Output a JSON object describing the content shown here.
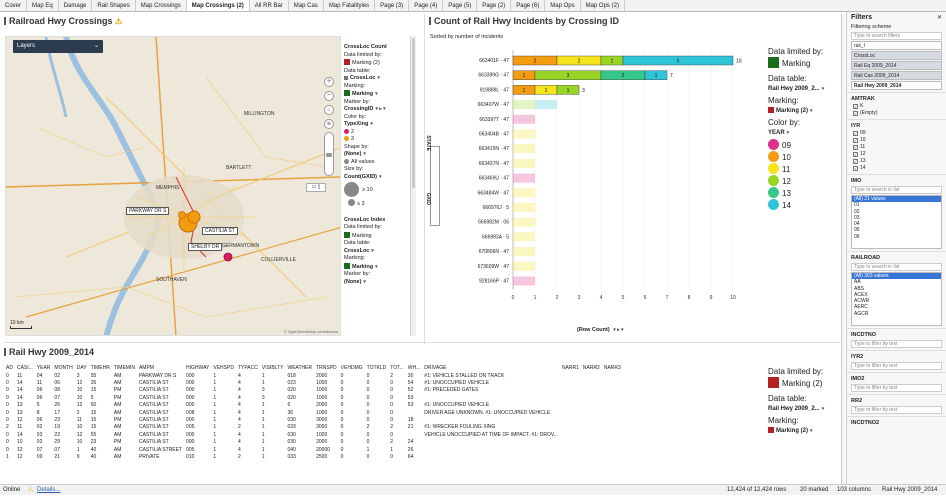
{
  "tabs": [
    "Cover",
    "Map Eq",
    "Damage",
    "Rail Shapes",
    "Map Crossings",
    "Map Crossings (2)",
    "All RR Bar",
    "Map Cas",
    "Map Fatalityies",
    "Page (3)",
    "Page (4)",
    "Page (5)",
    "Page (2)",
    "Page (6)",
    "Map Ops",
    "Map Ops (2)"
  ],
  "map_panel": {
    "title": "Railroad Hwy Crossings",
    "layers_label": "Layers",
    "scale_label": "10 km",
    "copyright": "© OpenStreetMap contributors",
    "places": [
      "MEMPHIS",
      "GERMANTOWN",
      "COLLIERVILLE",
      "SOUTHAVEN",
      "BARTLETT",
      "MILLINGTON"
    ],
    "callouts": [
      "PARKWAY DR S",
      "CASTILIA ST",
      "SHELBY DR"
    ]
  },
  "map_legend": {
    "title1": "CrossLoc Count",
    "limited_by": "Data limited by:",
    "marking2": "Marking (2)",
    "table_lbl": "Data table:",
    "table_val": "CrossLoc",
    "marking_lbl": "Marking:",
    "marking_val": "Marking",
    "marker_by_lbl": "Marker by:",
    "marker_by_val": "CrossingID",
    "color_by_lbl": "Color by:",
    "color_by_val": "TypeXing",
    "color_vals": [
      "2",
      "3"
    ],
    "shape_by_lbl": "Shape by:",
    "shape_by_val": "(None)",
    "all_values": "All values",
    "size_by_lbl": "Size by:",
    "size_by_val": "Count(GXID)",
    "size_vals": [
      "≥ 10",
      "≤ 3"
    ],
    "index_title": "CrossLoc Index",
    "limited_by2": "Data limited by:",
    "marking3": "Marking",
    "table_lbl2": "Data table:",
    "table_val2": "CrossLoc",
    "marking_lbl2": "Marking:",
    "marking_val2": "Marking",
    "marker_by_lbl2": "Marker by:",
    "marker_by_val2": "(None)"
  },
  "chart_panel": {
    "title": "Count of Rail Hwy Incidents by Crossing ID",
    "subtitle": "Sorted by number of incidents",
    "x_axis_title": "(Row Count)",
    "shelf_a": "STATE",
    "shelf_b": "GXID"
  },
  "chart_legend": {
    "limited_by": "Data limited by:",
    "marking": "Marking",
    "table_lbl": "Data table:",
    "table_val": "Rail Hwy 2009_2...",
    "marking_lbl": "Marking:",
    "marking_val": "Marking (2)",
    "color_by_lbl": "Color by:",
    "color_by_val": "YEAR",
    "years": [
      "09",
      "10",
      "11",
      "12",
      "13",
      "14"
    ],
    "year_colors": [
      "#e0318a",
      "#f39c12",
      "#f5e31b",
      "#9ad425",
      "#34c98a",
      "#2ec5d8"
    ]
  },
  "chart_data": {
    "type": "bar",
    "orientation": "horizontal",
    "stacked": true,
    "categories": [
      "663401F · 47",
      "663399G · 47",
      "919889L · 47",
      "663407W · 47",
      "663397T · 47",
      "663404B · 47",
      "663415N · 47",
      "663437N · 47",
      "663469U · 47",
      "663484W · 47",
      "666976J · 5",
      "666982M · 06",
      "666993A · 5",
      "670806N · 47",
      "673609W · 47",
      "928166P · 47"
    ],
    "xlim": [
      0,
      10
    ],
    "x_ticks": [
      "0",
      "1",
      "2",
      "3",
      "4",
      "5",
      "6",
      "7",
      "8",
      "9",
      "10"
    ],
    "series": [
      {
        "name": "09",
        "color": "#e0318a",
        "values": [
          0,
          0,
          0,
          0,
          1,
          0,
          0,
          0,
          1,
          0,
          0,
          0,
          0,
          0,
          0,
          1
        ]
      },
      {
        "name": "10",
        "color": "#f39c12",
        "values": [
          2,
          1,
          1,
          0,
          0,
          0,
          0,
          0,
          0,
          0,
          0,
          0,
          0,
          0,
          0,
          0
        ]
      },
      {
        "name": "11",
        "color": "#f5e31b",
        "values": [
          2,
          0,
          1,
          0,
          0,
          1,
          1,
          1,
          0,
          1,
          1,
          1,
          1,
          1,
          1,
          0
        ]
      },
      {
        "name": "12",
        "color": "#9ad425",
        "values": [
          1,
          3,
          1,
          1,
          0,
          0,
          0,
          0,
          0,
          0,
          0,
          0,
          0,
          0,
          0,
          0
        ]
      },
      {
        "name": "13",
        "color": "#34c98a",
        "values": [
          0,
          2,
          0,
          0,
          0,
          0,
          0,
          0,
          0,
          0,
          0,
          0,
          0,
          0,
          0,
          0
        ]
      },
      {
        "name": "14",
        "color": "#2ec5d8",
        "values": [
          5,
          1,
          0,
          1,
          0,
          0,
          0,
          0,
          0,
          0,
          0,
          0,
          0,
          0,
          0,
          0
        ]
      }
    ],
    "marked_rows": [
      0,
      1,
      2
    ],
    "totals": [
      "10",
      "7",
      "3",
      "",
      "",
      "",
      "",
      "",
      "",
      "",
      "",
      "",
      "",
      "",
      "",
      ""
    ]
  },
  "table_panel": {
    "title": "Rail Hwy 2009_2014",
    "columns": [
      "AD",
      "CASI...",
      "YEAR",
      "MONTH",
      "DAY",
      "TIMEHR",
      "TIMEMIN",
      "AMPM",
      "HIGHWAY",
      "VEHSPD",
      "TYPACC",
      "VISIBLTY",
      "WEATHER",
      "TRNSPD",
      "VEHDMG",
      "TOTKLD",
      "TOT...",
      "WH...",
      "DRIVAGE",
      "NARR1",
      "NARR2",
      "NARR3"
    ],
    "rows": [
      [
        "0",
        "11",
        "04",
        "02",
        "3",
        "55",
        "AM",
        "PARKWAY DR S",
        "000",
        "1",
        "4",
        "1",
        "018",
        "2000",
        "0",
        "0",
        "2",
        "30",
        "#1: VEHICLE STALLED ON TRACK",
        "",
        ""
      ],
      [
        "0",
        "14",
        "11",
        "06",
        "12",
        "35",
        "AM",
        "CASTILIA ST",
        "000",
        "1",
        "4",
        "1",
        "023",
        "1000",
        "0",
        "0",
        "0",
        "54",
        "#1: UNOCCUPIED VEHICLE",
        "",
        ""
      ],
      [
        "0",
        "14",
        "06",
        "08",
        "10",
        "15",
        "PM",
        "CASTILIA ST",
        "000",
        "1",
        "4",
        "3",
        "020",
        "1000",
        "0",
        "0",
        "0",
        "52",
        "#1: PRECEDED GATES",
        "",
        ""
      ],
      [
        "0",
        "14",
        "06",
        "07",
        "10",
        "5",
        "PM",
        "CASTILIA ST",
        "000",
        "1",
        "4",
        "3",
        "020",
        "1000",
        "0",
        "0",
        "0",
        "53",
        "",
        "",
        ""
      ],
      [
        "0",
        "13",
        "5",
        "26",
        "12",
        "50",
        "AM",
        "CASTILIA ST",
        "000",
        "1",
        "4",
        "1",
        "6",
        "2000",
        "0",
        "0",
        "0",
        "53",
        "#1: UNOCCUPIED VEHICLE",
        "",
        ""
      ],
      [
        "0",
        "13",
        "8",
        "17",
        "2",
        "15",
        "AM",
        "CASTILIA ST",
        "008",
        "1",
        "4",
        "1",
        "36",
        "1000",
        "0",
        "0",
        "0",
        "",
        "DRIVER AGE UNKNOWN. #1: UNOCCUPIED VEHICLE",
        "",
        ""
      ],
      [
        "0",
        "12",
        "06",
        "23",
        "11",
        "15",
        "PM",
        "CASTILIA ST",
        "000",
        "1",
        "4",
        "1",
        "030",
        "3000",
        "0",
        "0",
        "0",
        "18",
        "",
        "",
        ""
      ],
      [
        "2",
        "11",
        "02",
        "19",
        "10",
        "15",
        "AM",
        "CASTILIA ST",
        "005",
        "1",
        "2",
        "1",
        "033",
        "3000",
        "0",
        "2",
        "2",
        "21",
        "#1: WRECKER FOULING XING",
        "",
        ""
      ],
      [
        "0",
        "14",
        "03",
        "22",
        "12",
        "55",
        "AM",
        "CASTILIA ST",
        "000",
        "1",
        "4",
        "1",
        "030",
        "1000",
        "0",
        "0",
        "0",
        "",
        "VEHICLE UNOCCUPIED AT TIME OF IMPACT. #1: DROV...",
        "",
        ""
      ],
      [
        "0",
        "10",
        "02",
        "29",
        "10",
        "23",
        "PM",
        "CASTILIA ST",
        "000",
        "1",
        "4",
        "1",
        "030",
        "2000",
        "0",
        "0",
        "2",
        "24",
        "",
        "",
        ""
      ],
      [
        "0",
        "12",
        "07",
        "07",
        "1",
        "40",
        "AM",
        "CASTILIA STREET",
        "005",
        "1",
        "4",
        "1",
        "040",
        "20000",
        "0",
        "1",
        "1",
        "26",
        "",
        "",
        ""
      ],
      [
        "1",
        "12",
        "09",
        "21",
        "9",
        "40",
        "AM",
        "PRIVATE",
        "010",
        "1",
        "2",
        "1",
        "033",
        "2500",
        "0",
        "0",
        "0",
        "64",
        "",
        "",
        ""
      ]
    ]
  },
  "table_legend": {
    "limited_by": "Data limited by:",
    "marking": "Marking (2)",
    "table_lbl": "Data table:",
    "table_val": "Rail Hwy 2009_2...",
    "marking_lbl": "Marking:",
    "marking_val": "Marking (2)"
  },
  "filters": {
    "title": "Filters",
    "scheme_lbl": "Filtering scheme",
    "search_ph": "Type to search filters",
    "tables": [
      "rail_I",
      "CrossLoc",
      "Rail Eq 2009_2014",
      "Rail Cas 2009_2014",
      "Rail Hwy 2009_2014"
    ],
    "amtrak_title": "AMTRAK",
    "amtrak_opts": [
      "K",
      "(Empty)"
    ],
    "iyr_title": "IYR",
    "iyr_opts": [
      "09",
      "10",
      "11",
      "12",
      "13",
      "14"
    ],
    "imo_title": "IMO",
    "imo_search": "Type to search in list",
    "imo_items": [
      "(All) 21 values",
      "01",
      "02",
      "03",
      "04",
      "05",
      "06"
    ],
    "railroad_title": "RAILROAD",
    "railroad_search": "Type to search in list",
    "railroad_items": [
      "(All) 303 values",
      "AA",
      "ABS",
      "ACEX",
      "ACWR",
      "AERC",
      "AGCR"
    ],
    "incdtno_title": "INCDTNO",
    "iyr2_title": "IYR2",
    "imo2_title": "IMO2",
    "rr2_title": "RR2",
    "incdtno2_title": "INCDTNO2",
    "filter_ph": "Type to filter by text"
  },
  "status": {
    "online": "Online",
    "details": "Details...",
    "rows": "12,424 of 12,424 rows",
    "marked": "20 marked",
    "columns": "103 columns",
    "table": "Rail Hwy 2009_2014"
  }
}
